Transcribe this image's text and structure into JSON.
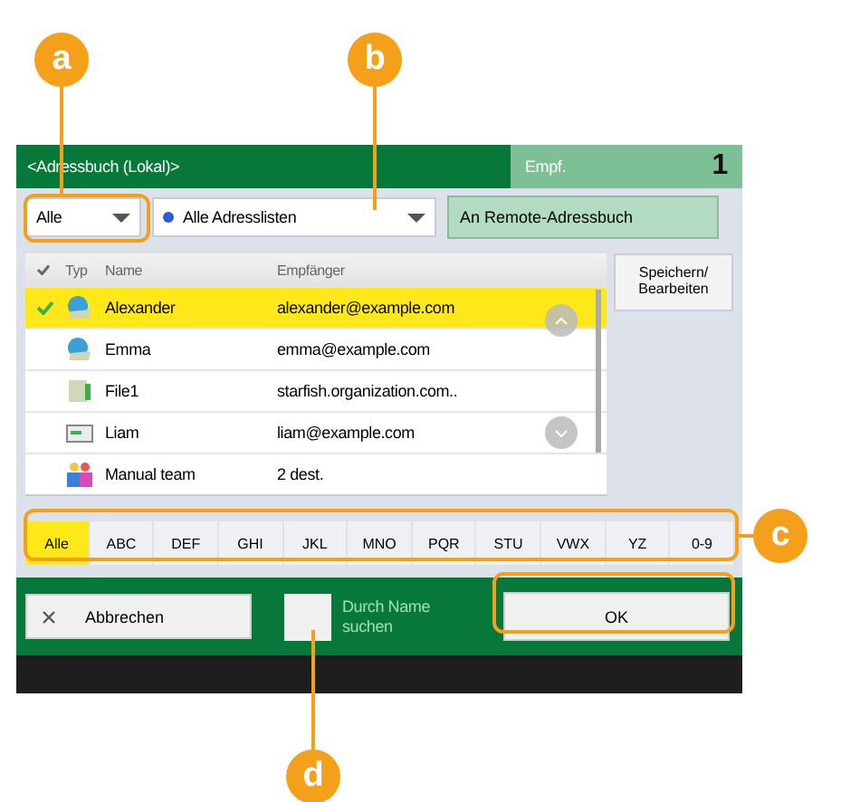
{
  "screen": {
    "title": "<Adressbuch (Lokal)>",
    "recipients_label": "Empf.",
    "recipients_count": "1",
    "filter": {
      "value": "Alle"
    },
    "address_list": {
      "value": "Alle Adresslisten"
    },
    "remote_button": "An Remote-Adressbuch",
    "columns": [
      "Typ",
      "Name",
      "Empfänger"
    ],
    "rows": [
      {
        "kind": "email",
        "name": "Alexander",
        "recipient": "alexander@example.com",
        "selected": true
      },
      {
        "kind": "email",
        "name": "Emma",
        "recipient": "emma@example.com",
        "selected": false
      },
      {
        "kind": "file",
        "name": "File1",
        "recipient": "starfish.organization.com..",
        "selected": false
      },
      {
        "kind": "fax",
        "name": "Liam",
        "recipient": "liam@example.com",
        "selected": false
      },
      {
        "kind": "group",
        "name": "Manual team",
        "recipient": "2 dest.",
        "selected": false
      }
    ],
    "save_button": "Speichern/ Bearbeiten",
    "letters": [
      {
        "label": "Alle",
        "selected": true
      },
      {
        "label": "ABC",
        "selected": false
      },
      {
        "label": "DEF",
        "selected": false
      },
      {
        "label": "GHI",
        "selected": false
      },
      {
        "label": "JKL",
        "selected": false
      },
      {
        "label": "MNO",
        "selected": false
      },
      {
        "label": "PQR",
        "selected": false
      },
      {
        "label": "STU",
        "selected": false
      },
      {
        "label": "VWX",
        "selected": false
      },
      {
        "label": "YZ",
        "selected": false
      },
      {
        "label": "0-9",
        "selected": false
      }
    ],
    "cancel_button": "Abbrechen",
    "search_by_name": {
      "label": "Durch Name suchen",
      "checked": false
    },
    "ok_button": "OK"
  },
  "callouts": [
    {
      "label": "a"
    },
    {
      "label": "b"
    },
    {
      "label": "c"
    },
    {
      "label": "d"
    }
  ]
}
